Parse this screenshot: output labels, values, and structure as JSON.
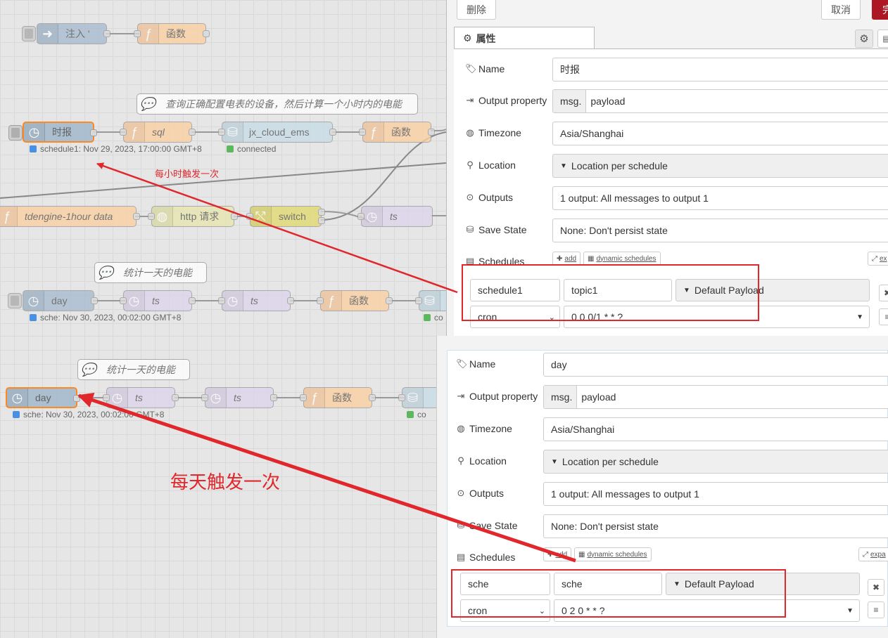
{
  "flow1": {
    "nodes": {
      "inject": "注入 '",
      "func_top": "函数",
      "comment1": "查询正确配置电表的设备，然后计算一个小时内的电能",
      "shibao": "时报",
      "sql": "sql",
      "jx_cloud_ems": "jx_cloud_ems",
      "func2": "函数",
      "tdengine": "tdengine-1hour data",
      "http": "http 请求",
      "switch": "switch",
      "ts1": "ts",
      "comment2": "统计一天的电能",
      "day": "day",
      "ts2": "ts",
      "ts3": "ts",
      "func3": "函数",
      "co": "co"
    },
    "status": {
      "schedule1": "schedule1: Nov 29, 2023, 17:00:00 GMT+8",
      "connected": "connected",
      "sche": "sche: Nov 30, 2023, 00:02:00 GMT+8"
    },
    "annotation": "每小时触发一次"
  },
  "flow2": {
    "nodes": {
      "comment": "统计一天的电能",
      "day": "day",
      "ts1": "ts",
      "ts2": "ts",
      "func": "函数",
      "co": "co"
    },
    "status": {
      "sche": "sche: Nov 30, 2023, 00:02:00 GMT+8"
    },
    "annotation": "每天触发一次"
  },
  "panel1": {
    "delete_label": "删除",
    "cancel_label": "取消",
    "done_label": "完",
    "tab_label": "属性",
    "name_label": "Name",
    "name_value": "时报",
    "output_label": "Output property",
    "output_prefix": "msg.",
    "output_value": "payload",
    "timezone_label": "Timezone",
    "timezone_value": "Asia/Shanghai",
    "location_label": "Location",
    "location_value": "Location per schedule",
    "outputs_label": "Outputs",
    "outputs_value": "1 output: All messages to output 1",
    "save_label": "Save State",
    "save_value": "None: Don't persist state",
    "schedules_label": "Schedules",
    "add_label": "add",
    "dynamic_label": "dynamic schedules",
    "expand_label": "ex",
    "sched_name": "schedule1",
    "sched_topic": "topic1",
    "sched_payload": "Default Payload",
    "sched_type": "cron",
    "sched_expr": "0 0 0/1 * * ?"
  },
  "panel2": {
    "name_label": "Name",
    "name_value": "day",
    "output_label": "Output property",
    "output_prefix": "msg.",
    "output_value": "payload",
    "timezone_label": "Timezone",
    "timezone_value": "Asia/Shanghai",
    "location_label": "Location",
    "location_value": "Location per schedule",
    "outputs_label": "Outputs",
    "outputs_value": "1 output: All messages to output 1",
    "save_label": "Save State",
    "save_value": "None: Don't persist state",
    "schedules_label": "Schedules",
    "add_label": "add",
    "dynamic_label": "dynamic schedules",
    "expand_label": "expa",
    "sched_name": "sche",
    "sched_topic": "sche",
    "sched_payload": "Default Payload",
    "sched_type": "cron",
    "sched_expr": "0 2 0 * * ?"
  },
  "colors": {
    "inject": "#a6bbcf",
    "function": "#fdd0a2",
    "database": "#c8dde6",
    "http": "#e7e7ae",
    "switch": "#e2d96e",
    "timestamp": "#dcd5ec",
    "annotation": "#e0272b",
    "done_button": "#ad1625"
  }
}
